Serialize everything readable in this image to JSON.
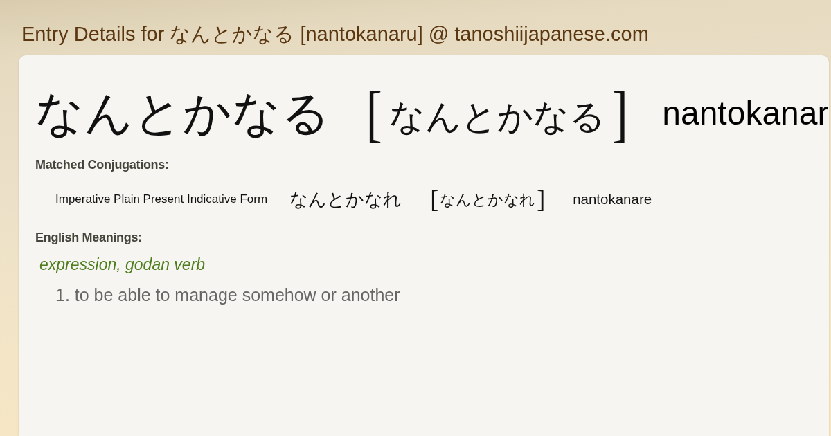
{
  "page_title": "Entry Details for なんとかなる [nantokanaru] @ tanoshiijapanese.com",
  "entry": {
    "word": "なんとかなる",
    "reading": {
      "open": "[",
      "text": "なんとかなる",
      "close": "]"
    },
    "romaji": "nantokanar"
  },
  "conjugations": {
    "heading": "Matched Conjugations:",
    "items": [
      {
        "form": "Imperative Plain Present Indicative Form",
        "word": "なんとかなれ",
        "reading": {
          "open": "[",
          "text": "なんとかなれ",
          "close": "]"
        },
        "romaji": "nantokanare"
      }
    ]
  },
  "meanings": {
    "heading": "English Meanings:",
    "part_of_speech": "expression, godan verb",
    "senses": [
      {
        "number": "1.",
        "text": "to be able to manage somehow or another"
      }
    ]
  }
}
